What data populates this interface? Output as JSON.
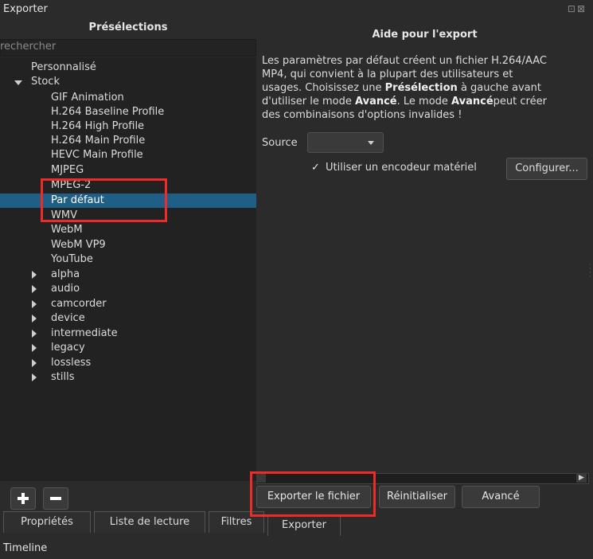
{
  "window": {
    "title": "Exporter",
    "title_icons": "⊡⊠"
  },
  "presets": {
    "title": "Présélections",
    "search_placeholder": "rechercher",
    "items": [
      {
        "label": "Personnalisé"
      },
      {
        "label": "Stock"
      },
      {
        "label": "GIF Animation"
      },
      {
        "label": "H.264 Baseline Profile"
      },
      {
        "label": "H.264 High Profile"
      },
      {
        "label": "H.264 Main Profile"
      },
      {
        "label": "HEVC Main Profile"
      },
      {
        "label": "MJPEG"
      },
      {
        "label": "MPEG-2"
      },
      {
        "label": "Par défaut"
      },
      {
        "label": "WMV"
      },
      {
        "label": "WebM"
      },
      {
        "label": "WebM VP9"
      },
      {
        "label": "YouTube"
      },
      {
        "label": "alpha"
      },
      {
        "label": "audio"
      },
      {
        "label": "camcorder"
      },
      {
        "label": "device"
      },
      {
        "label": "intermediate"
      },
      {
        "label": "legacy"
      },
      {
        "label": "lossless"
      },
      {
        "label": "stills"
      }
    ]
  },
  "help": {
    "title": "Aide pour l'export",
    "line1": "Les paramètres par défaut créent un fichier H.264/AAC",
    "line2": "MP4, qui convient à la plupart des utilisateurs et",
    "line3a": "usages. Choisissez une ",
    "line3b": "Présélection",
    "line3c": " à gauche avant",
    "line4a": "d'utiliser le mode ",
    "line4b": "Avancé",
    "line4c": ". Le mode ",
    "line4d": "Avancé",
    "line4e": "peut créer",
    "line5": "des combinaisons d'options invalides !"
  },
  "source": {
    "label": "Source",
    "value": ""
  },
  "hardware": {
    "checkmark": "✓",
    "label": "Utiliser un encodeur matériel",
    "checked": true
  },
  "buttons": {
    "configure": "Configurer...",
    "export_file": "Exporter le fichier",
    "reset": "Réinitialiser",
    "advanced": "Avancé"
  },
  "tabs": [
    "Propriétés",
    "Liste de lecture",
    "Filtres",
    "Exporter"
  ],
  "timeline": "Timeline",
  "colors": {
    "selection": "#1f5f86",
    "highlight_box": "#ee2a2a",
    "panel": "#2b2b2b"
  }
}
